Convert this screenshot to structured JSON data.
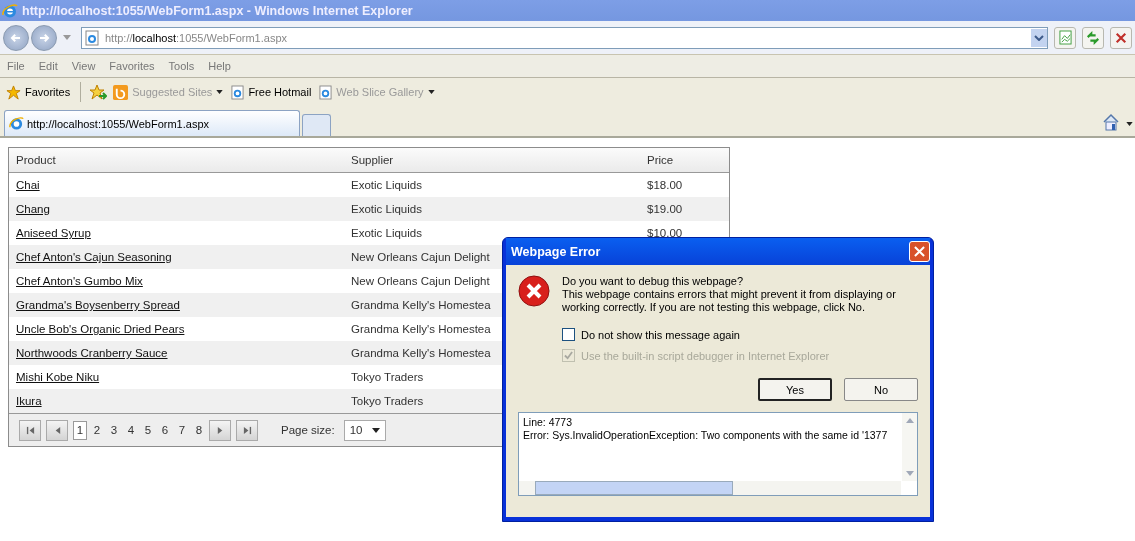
{
  "window": {
    "title": "http://localhost:1055/WebForm1.aspx - Windows Internet Explorer"
  },
  "address": {
    "scheme": "http://",
    "host": "localhost",
    "rest": ":1055/WebForm1.aspx"
  },
  "menu": [
    "File",
    "Edit",
    "View",
    "Favorites",
    "Tools",
    "Help"
  ],
  "favorites_bar": [
    {
      "label": "Favorites",
      "kind": "favorites",
      "dimmed": false,
      "dropdown": false
    },
    {
      "label": "Suggested Sites",
      "kind": "suggested",
      "dimmed": true,
      "dropdown": true
    },
    {
      "label": "Free Hotmail",
      "kind": "page",
      "dimmed": false,
      "dropdown": false
    },
    {
      "label": "Web Slice Gallery",
      "kind": "page",
      "dimmed": true,
      "dropdown": true
    }
  ],
  "tabs": [
    {
      "label": "http://localhost:1055/WebForm1.aspx",
      "selected": true
    }
  ],
  "grid": {
    "columns": [
      "Product",
      "Supplier",
      "Price"
    ],
    "rows": [
      {
        "product": "Chai",
        "supplier": "Exotic Liquids",
        "price": "$18.00"
      },
      {
        "product": "Chang",
        "supplier": "Exotic Liquids",
        "price": "$19.00"
      },
      {
        "product": "Aniseed Syrup",
        "supplier": "Exotic Liquids",
        "price": "$10.00"
      },
      {
        "product": "Chef Anton's Cajun Seasoning",
        "supplier": "New Orleans Cajun Delight"
      },
      {
        "product": "Chef Anton's Gumbo Mix",
        "supplier": "New Orleans Cajun Delight"
      },
      {
        "product": "Grandma's Boysenberry Spread",
        "supplier": "Grandma Kelly's Homestea"
      },
      {
        "product": "Uncle Bob's Organic Dried Pears",
        "supplier": "Grandma Kelly's Homestea"
      },
      {
        "product": "Northwoods Cranberry Sauce",
        "supplier": "Grandma Kelly's Homestea"
      },
      {
        "product": "Mishi Kobe Niku",
        "supplier": "Tokyo Traders"
      },
      {
        "product": "Ikura",
        "supplier": "Tokyo Traders"
      }
    ],
    "pages": [
      {
        "label": "1",
        "selected": true
      },
      {
        "label": "2",
        "selected": false
      },
      {
        "label": "3",
        "selected": false
      },
      {
        "label": "4",
        "selected": false
      },
      {
        "label": "5",
        "selected": false
      },
      {
        "label": "6",
        "selected": false
      },
      {
        "label": "7",
        "selected": false
      },
      {
        "label": "8",
        "selected": false
      }
    ],
    "page_size_label": "Page size:",
    "page_size": "10"
  },
  "dialog": {
    "title": "Webpage Error",
    "question": "Do you want to debug this webpage?",
    "message": "This webpage contains errors that might prevent it from displaying or working correctly. If you are not testing this webpage, click No.",
    "options": [
      {
        "label": "Do not show this message again",
        "checked": false,
        "disabled": false
      },
      {
        "label": "Use the built-in script debugger in Internet Explorer",
        "checked": true,
        "disabled": true
      }
    ],
    "buttons": [
      {
        "label": "Yes",
        "default": true
      },
      {
        "label": "No",
        "default": false
      }
    ],
    "details": [
      "Line: 4773",
      "Error: Sys.InvalidOperationException: Two components with the same id '1377"
    ]
  }
}
